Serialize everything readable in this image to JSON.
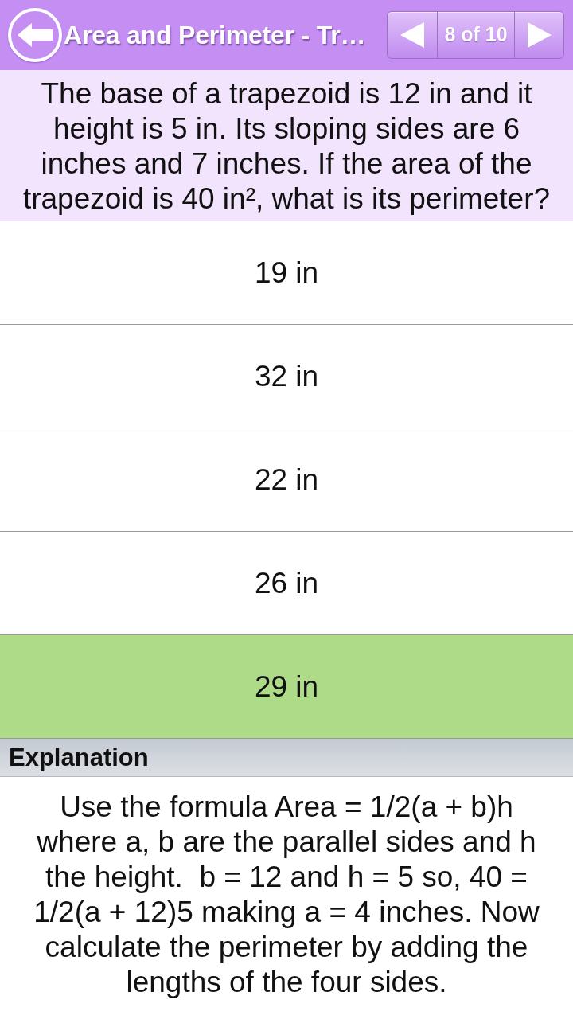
{
  "header": {
    "title": "Area and Perimeter - Tr…",
    "counter": "8 of 10"
  },
  "question": "The base of a trapezoid is 12 in and it height is 5 in. Its sloping sides are 6 inches and 7 inches. If the area of the trapezoid is 40 in², what is its perimeter?",
  "answers": [
    {
      "text": "19 in",
      "correct": false
    },
    {
      "text": "32 in",
      "correct": false
    },
    {
      "text": "22 in",
      "correct": false
    },
    {
      "text": "26 in",
      "correct": false
    },
    {
      "text": "29 in",
      "correct": true
    }
  ],
  "explanation": {
    "heading": "Explanation",
    "text": "Use the formula Area = 1/2(a + b)h where a, b are the parallel sides and h the height.  b = 12 and h = 5 so, 40 = 1/2(a + 12)5 making a = 4 inches. Now calculate the perimeter by adding the lengths of the four sides."
  }
}
